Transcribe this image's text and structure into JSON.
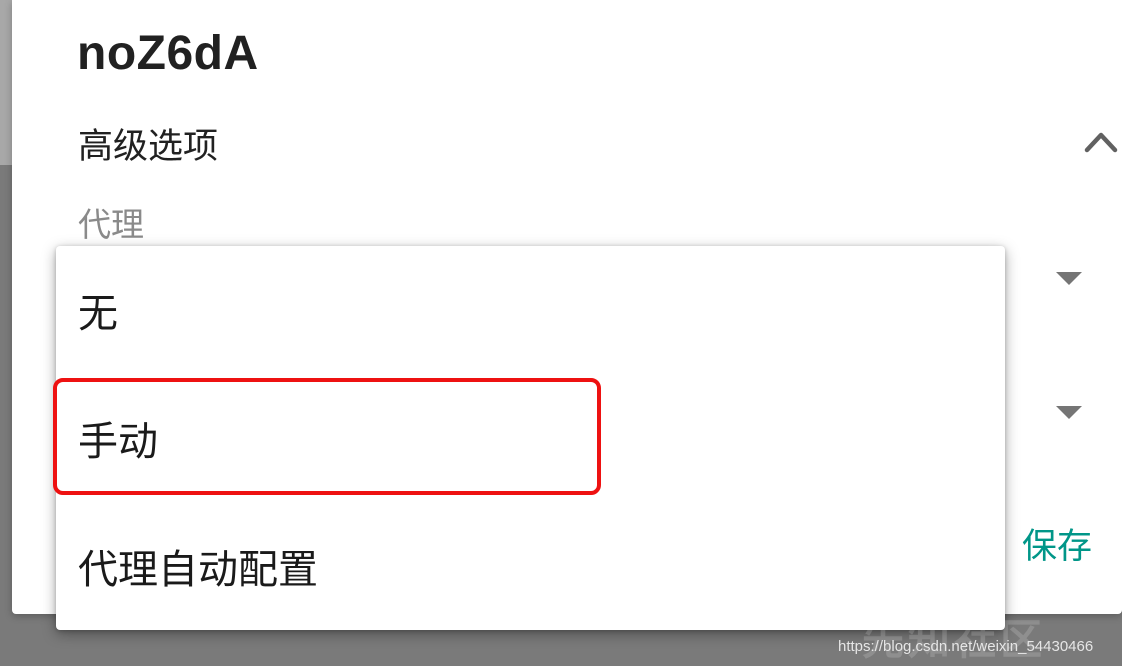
{
  "dialog": {
    "title": "noZ6dA",
    "advanced_options_label": "高级选项",
    "proxy_label": "代理",
    "save_label": "保存"
  },
  "proxy_menu": {
    "items": [
      {
        "label": "无"
      },
      {
        "label": "手动"
      },
      {
        "label": "代理自动配置"
      }
    ],
    "highlighted_item": "手动"
  },
  "colors": {
    "accent": "#009688",
    "highlight_border": "#ee1111",
    "text_primary": "#212121",
    "text_secondary": "#8a8a8a"
  },
  "icons": {
    "collapse": "chevron-up-icon",
    "dropdown": "triangle-down-icon"
  },
  "watermark": {
    "logo_text": "先知社区",
    "url": "https://blog.csdn.net/weixin_54430466"
  }
}
